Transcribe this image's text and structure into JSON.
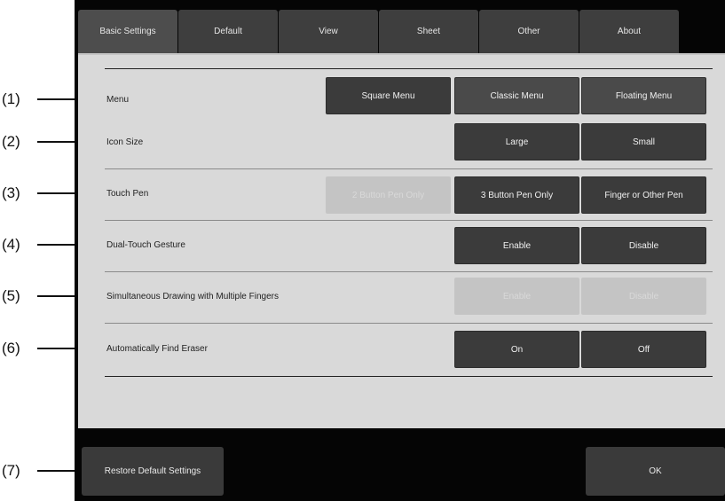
{
  "callouts": [
    "(1)",
    "(2)",
    "(3)",
    "(4)",
    "(5)",
    "(6)",
    "(7)"
  ],
  "tabs": [
    "Basic Settings",
    "Default",
    "View",
    "Sheet",
    "Other",
    "About"
  ],
  "settings": {
    "menu": {
      "label": "Menu",
      "options": [
        "Square Menu",
        "Classic Menu",
        "Floating Menu"
      ]
    },
    "icon_size": {
      "label": "Icon Size",
      "options": [
        "Large",
        "Small"
      ]
    },
    "touch_pen": {
      "label": "Touch Pen",
      "options": [
        "2 Button Pen Only",
        "3 Button Pen Only",
        "Finger or Other Pen"
      ]
    },
    "dual_touch": {
      "label": "Dual-Touch Gesture",
      "options": [
        "Enable",
        "Disable"
      ]
    },
    "simultaneous": {
      "label": "Simultaneous Drawing with Multiple Fingers",
      "options": [
        "Enable",
        "Disable"
      ]
    },
    "find_eraser": {
      "label": "Automatically Find Eraser",
      "options": [
        "On",
        "Off"
      ]
    }
  },
  "footer": {
    "restore_label": "Restore Default Settings",
    "ok_label": "OK"
  }
}
